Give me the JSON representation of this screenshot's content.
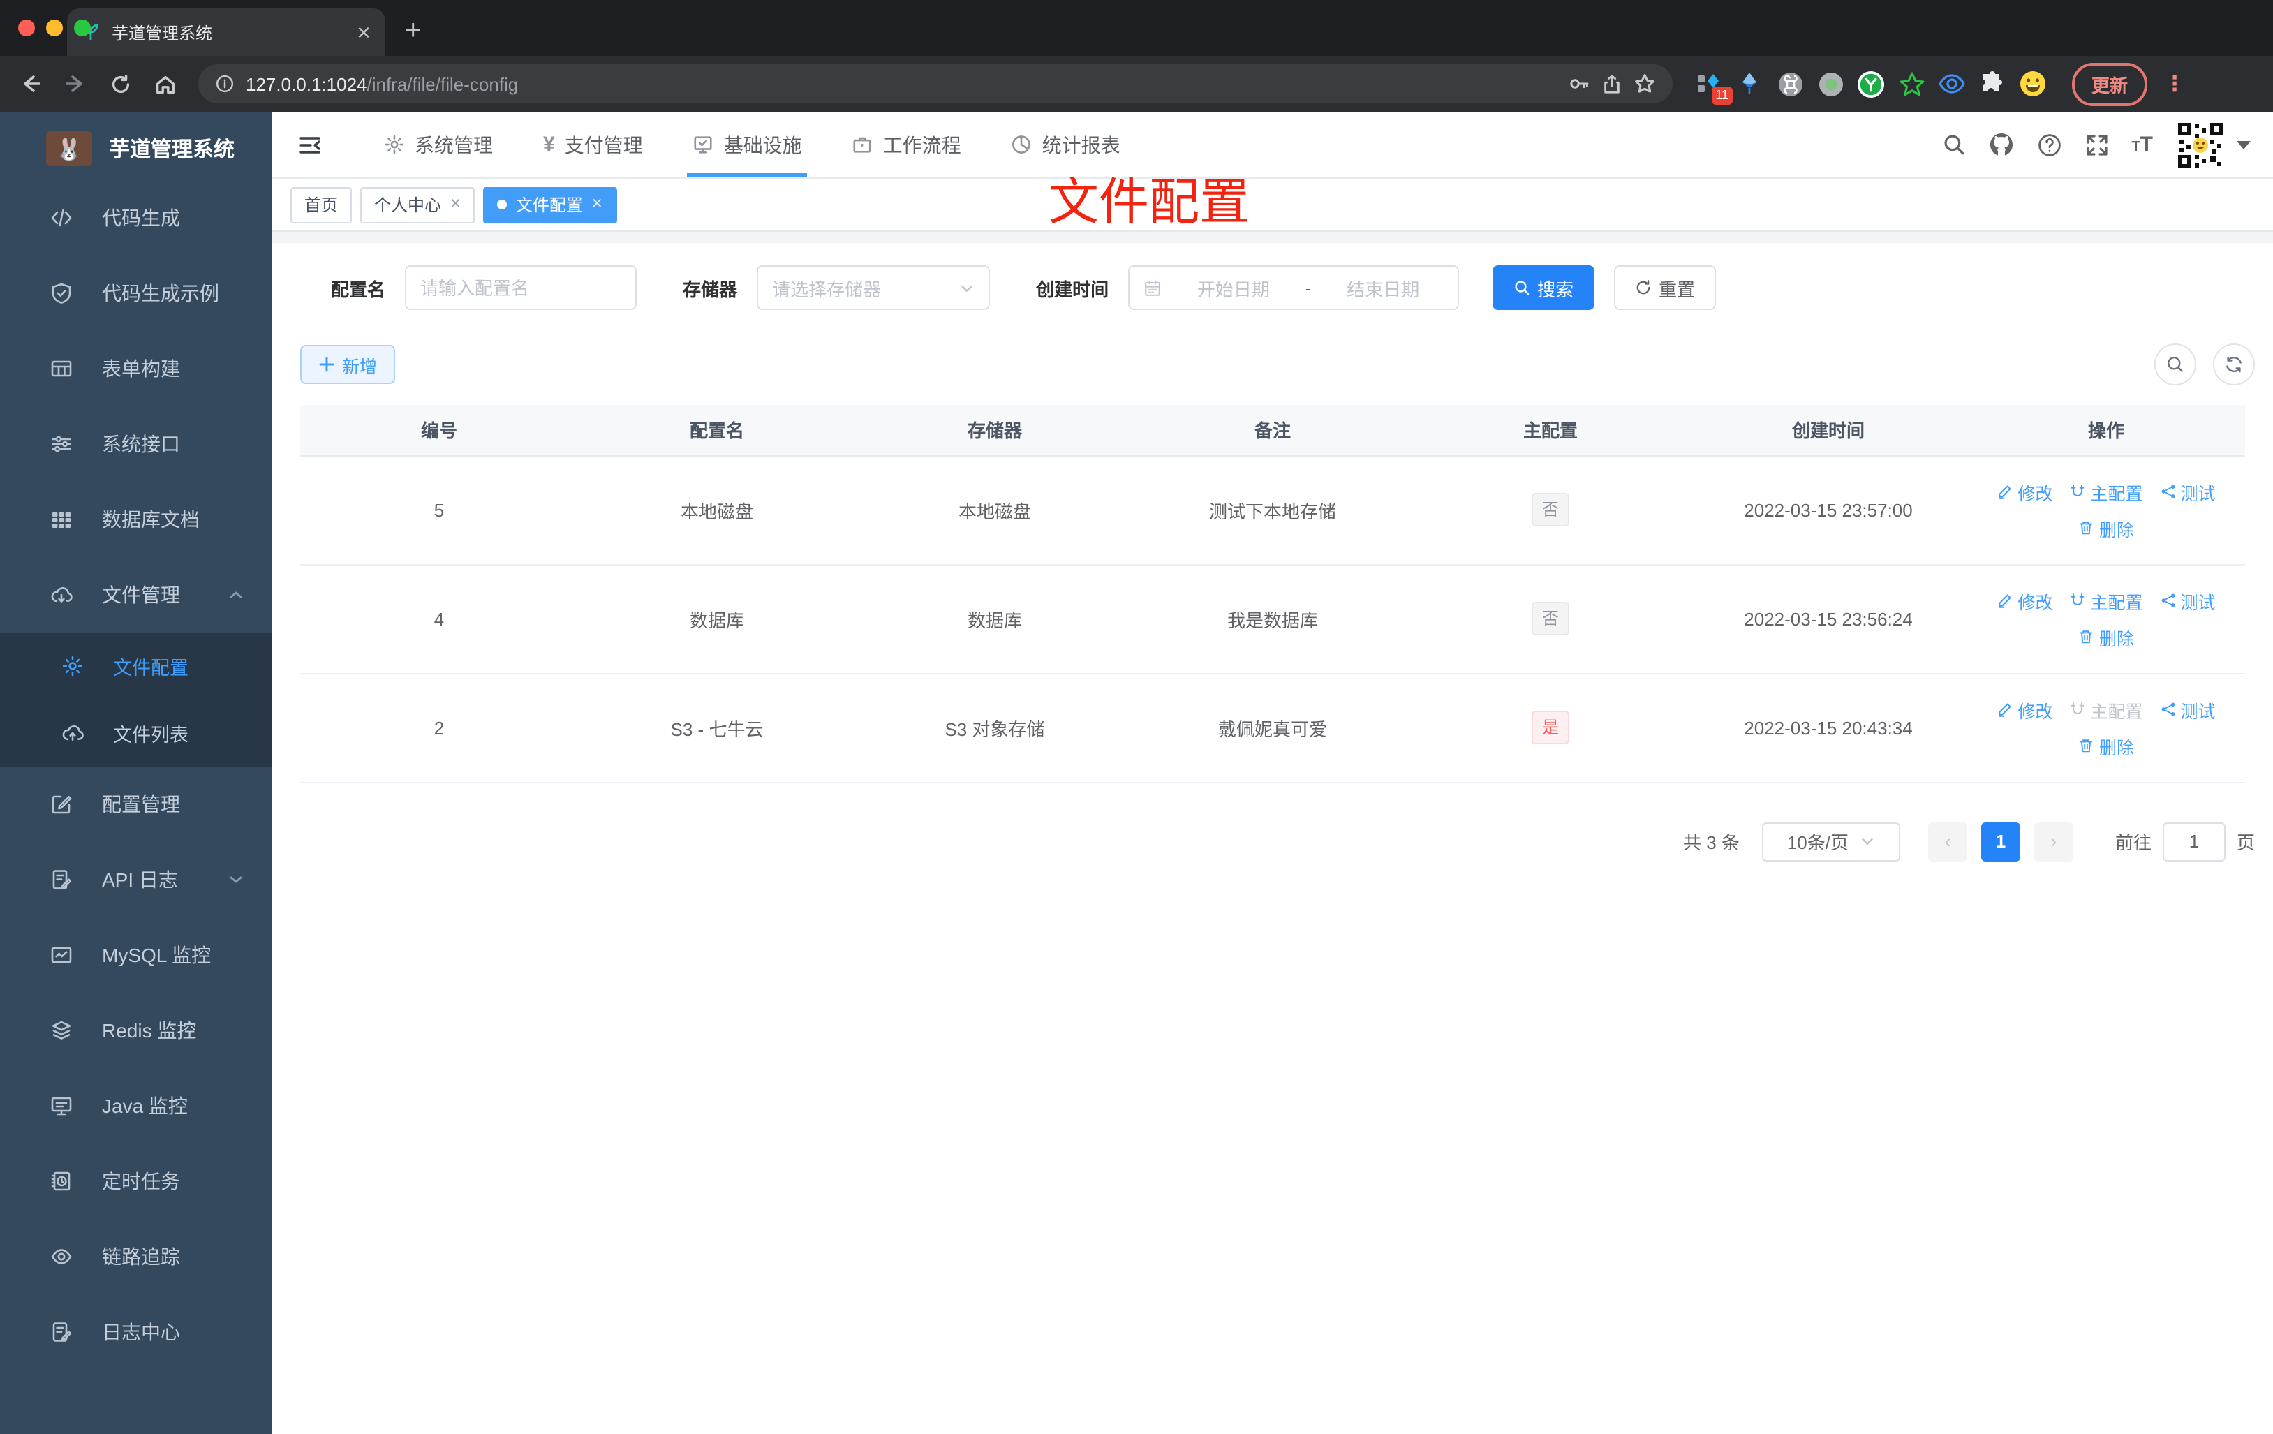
{
  "colors": {
    "accent": "#2583f8",
    "link": "#409eff",
    "sidebar": "#35495e",
    "submenu": "#273748",
    "danger": "#f56c6c"
  },
  "browser": {
    "tab_title": "芋道管理系统",
    "url_host": "127.0.0.1:1024",
    "url_path": "/infra/file/file-config",
    "extension_badge": "11",
    "update_button": "更新"
  },
  "sidebar": {
    "logo_title": "芋道管理系统",
    "items": [
      {
        "label": "代码生成"
      },
      {
        "label": "代码生成示例"
      },
      {
        "label": "表单构建"
      },
      {
        "label": "系统接口"
      },
      {
        "label": "数据库文档"
      },
      {
        "label": "文件管理"
      },
      {
        "label": "文件配置"
      },
      {
        "label": "文件列表"
      },
      {
        "label": "配置管理"
      },
      {
        "label": "API 日志"
      },
      {
        "label": "MySQL 监控"
      },
      {
        "label": "Redis 监控"
      },
      {
        "label": "Java 监控"
      },
      {
        "label": "定时任务"
      },
      {
        "label": "链路追踪"
      },
      {
        "label": "日志中心"
      }
    ]
  },
  "topnav": {
    "items": [
      {
        "label": "系统管理"
      },
      {
        "label": "支付管理"
      },
      {
        "label": "基础设施"
      },
      {
        "label": "工作流程"
      },
      {
        "label": "统计报表"
      }
    ]
  },
  "tabs": {
    "items": [
      {
        "label": "首页"
      },
      {
        "label": "个人中心"
      },
      {
        "label": "文件配置"
      }
    ]
  },
  "annotation": {
    "text": "文件配置"
  },
  "filter": {
    "name_label": "配置名",
    "name_placeholder": "请输入配置名",
    "storage_label": "存储器",
    "storage_placeholder": "请选择存储器",
    "time_label": "创建时间",
    "date_start": "开始日期",
    "date_separator": "-",
    "date_end": "结束日期",
    "search_label": "搜索",
    "reset_label": "重置"
  },
  "toolbar": {
    "add_label": "新增"
  },
  "table": {
    "columns": [
      "编号",
      "配置名",
      "存储器",
      "备注",
      "主配置",
      "创建时间",
      "操作"
    ],
    "actions": {
      "edit": "修改",
      "master": "主配置",
      "test": "测试",
      "delete": "删除"
    },
    "rows": [
      {
        "id": "5",
        "name": "本地磁盘",
        "storage": "本地磁盘",
        "remark": "测试下本地存储",
        "master": "否",
        "created": "2022-03-15 23:57:00"
      },
      {
        "id": "4",
        "name": "数据库",
        "storage": "数据库",
        "remark": "我是数据库",
        "master": "否",
        "created": "2022-03-15 23:56:24"
      },
      {
        "id": "2",
        "name": "S3 - 七牛云",
        "storage": "S3 对象存储",
        "remark": "戴佩妮真可爱",
        "master": "是",
        "created": "2022-03-15 20:43:34"
      }
    ]
  },
  "pagination": {
    "total": "共 3 条",
    "page_size": "10条/页",
    "page": "1",
    "goto_label": "前往",
    "goto_value": "1",
    "goto_unit": "页"
  }
}
